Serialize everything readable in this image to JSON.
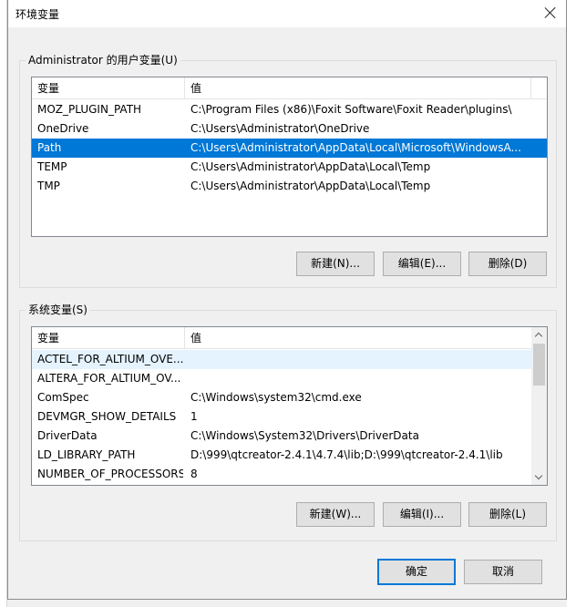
{
  "window": {
    "title": "环境变量",
    "close_label": "关闭"
  },
  "user_vars": {
    "group_label": "Administrator 的用户变量(U)",
    "headers": {
      "variable": "变量",
      "value": "值"
    },
    "rows": [
      {
        "name": "MOZ_PLUGIN_PATH",
        "value": "C:\\Program Files (x86)\\Foxit Software\\Foxit Reader\\plugins\\"
      },
      {
        "name": "OneDrive",
        "value": "C:\\Users\\Administrator\\OneDrive"
      },
      {
        "name": "Path",
        "value": "C:\\Users\\Administrator\\AppData\\Local\\Microsoft\\WindowsA...",
        "selected": true
      },
      {
        "name": "TEMP",
        "value": "C:\\Users\\Administrator\\AppData\\Local\\Temp"
      },
      {
        "name": "TMP",
        "value": "C:\\Users\\Administrator\\AppData\\Local\\Temp"
      }
    ],
    "buttons": {
      "new": "新建(N)...",
      "edit": "编辑(E)...",
      "delete": "删除(D)"
    }
  },
  "system_vars": {
    "group_label": "系统变量(S)",
    "headers": {
      "variable": "变量",
      "value": "值"
    },
    "rows": [
      {
        "name": "ACTEL_FOR_ALTIUM_OVE...",
        "value": "",
        "hover": true
      },
      {
        "name": "ALTERA_FOR_ALTIUM_OV...",
        "value": ""
      },
      {
        "name": "ComSpec",
        "value": "C:\\Windows\\system32\\cmd.exe"
      },
      {
        "name": "DEVMGR_SHOW_DETAILS",
        "value": "1"
      },
      {
        "name": "DriverData",
        "value": "C:\\Windows\\System32\\Drivers\\DriverData"
      },
      {
        "name": "LD_LIBRARY_PATH",
        "value": "D:\\999\\qtcreator-2.4.1\\4.7.4\\lib;D:\\999\\qtcreator-2.4.1\\lib"
      },
      {
        "name": "NUMBER_OF_PROCESSORS",
        "value": "8"
      }
    ],
    "buttons": {
      "new": "新建(W)...",
      "edit": "编辑(I)...",
      "delete": "删除(L)"
    }
  },
  "footer": {
    "ok": "确定",
    "cancel": "取消"
  },
  "colors": {
    "selection": "#0078d7",
    "default_button_border": "#0078d7",
    "button_face": "#e1e1e1"
  }
}
